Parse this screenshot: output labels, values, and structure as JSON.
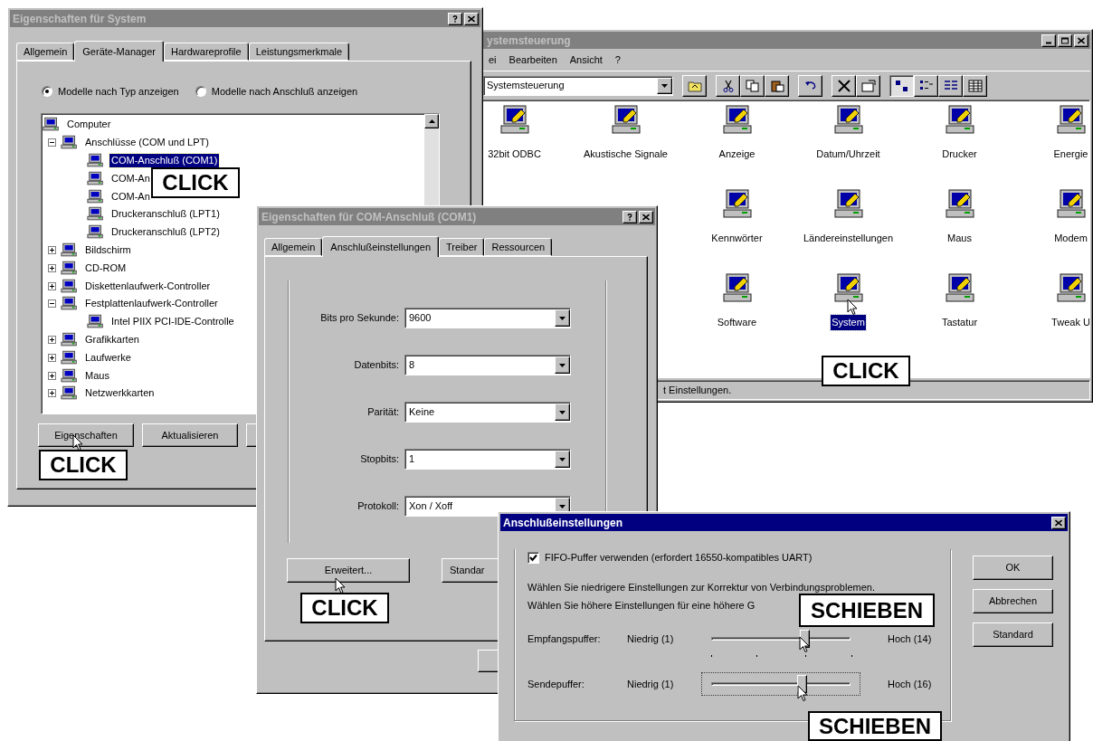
{
  "system_properties": {
    "title": "Eigenschaften für System",
    "active": false,
    "tabs": [
      {
        "label": "Allgemein",
        "selected": false
      },
      {
        "label": "Geräte-Manager",
        "selected": true
      },
      {
        "label": "Hardwareprofile",
        "selected": false
      },
      {
        "label": "Leistungsmerkmale",
        "selected": false
      }
    ],
    "view_options": [
      {
        "label": "Modelle nach Typ anzeigen",
        "selected": true
      },
      {
        "label": "Modelle nach Anschluß anzeigen",
        "selected": false
      }
    ],
    "device_tree": [
      {
        "label": "Computer",
        "selected": false,
        "children": [
          {
            "label": "Anschlüsse (COM und LPT)",
            "selected": false,
            "expanded": true,
            "children": [
              {
                "label": "COM-Anschluß (COM1)",
                "selected": true
              },
              {
                "label": "COM-An",
                "selected": false
              },
              {
                "label": "COM-An",
                "selected": false
              },
              {
                "label": "Druckeranschluß (LPT1)",
                "selected": false
              },
              {
                "label": "Druckeranschluß (LPT2)",
                "selected": false
              }
            ]
          },
          {
            "label": "Bildschirm",
            "selected": false,
            "expanded": false
          },
          {
            "label": "CD-ROM",
            "selected": false,
            "expanded": false
          },
          {
            "label": "Diskettenlaufwerk-Controller",
            "selected": false,
            "expanded": false
          },
          {
            "label": "Festplattenlaufwerk-Controller",
            "selected": false,
            "expanded": true,
            "children": [
              {
                "label": "Intel PIIX PCI-IDE-Controlle",
                "selected": false
              }
            ]
          },
          {
            "label": "Grafikkarten",
            "selected": false,
            "expanded": false
          },
          {
            "label": "Laufwerke",
            "selected": false,
            "expanded": false
          },
          {
            "label": "Maus",
            "selected": false,
            "expanded": false
          },
          {
            "label": "Netzwerkkarten",
            "selected": false,
            "expanded": false
          }
        ]
      }
    ],
    "buttons": [
      "Eigenschaften",
      "Aktualisieren"
    ]
  },
  "control_panel": {
    "title": "ystemsteuerung",
    "active": false,
    "menu": [
      "ei",
      "Bearbeiten",
      "Ansicht",
      "?"
    ],
    "address": "Systemsteuerung",
    "view_modes": [
      {
        "selected": true
      },
      {
        "selected": false
      },
      {
        "selected": false
      },
      {
        "selected": false
      }
    ],
    "icon_rows": [
      [
        {
          "label": "32bit ODBC",
          "selected": false
        },
        {
          "label": "Akustische Signale",
          "selected": false
        },
        {
          "label": "Anzeige",
          "selected": false
        },
        {
          "label": "Datum/Uhrzeit",
          "selected": false
        },
        {
          "label": "Drucker",
          "selected": false
        },
        {
          "label": "Energie",
          "selected": false
        }
      ],
      [
        {
          "label": "Kennwörter",
          "selected": false
        },
        {
          "label": "Ländereinstellungen",
          "selected": false
        },
        {
          "label": "Maus",
          "selected": false
        },
        {
          "label": "Modem",
          "selected": false
        }
      ],
      [
        {
          "label": "Software",
          "selected": false
        },
        {
          "label": "System",
          "selected": true
        },
        {
          "label": "Tastatur",
          "selected": false
        },
        {
          "label": "Tweak U",
          "selected": false
        }
      ]
    ],
    "status": "t Einstellungen."
  },
  "port_properties": {
    "title": "Eigenschaften für COM-Anschluß (COM1)",
    "active": false,
    "tabs": [
      {
        "label": "Allgemein",
        "selected": false
      },
      {
        "label": "Anschlußeinstellungen",
        "selected": true
      },
      {
        "label": "Treiber",
        "selected": false
      },
      {
        "label": "Ressourcen",
        "selected": false
      }
    ],
    "fields": [
      {
        "label": "Bits pro Sekunde:",
        "value": "9600"
      },
      {
        "label": "Datenbits:",
        "value": "8"
      },
      {
        "label": "Parität:",
        "value": "Keine"
      },
      {
        "label": "Stopbits:",
        "value": "1"
      },
      {
        "label": "Protokoll:",
        "value": "Xon / Xoff"
      }
    ],
    "buttons": [
      "Erweitert...",
      "Standar"
    ]
  },
  "advanced_settings": {
    "title": "Anschlußeinstellungen",
    "active": true,
    "fifo": {
      "label": "FIFO-Puffer verwenden (erfordert 16550-kompatibles UART)",
      "checked": true
    },
    "hints": [
      "Wählen Sie niedrigere Einstellungen zur Korrektur von Verbindungsproblemen.",
      "Wählen Sie höhere Einstellungen für eine höhere G"
    ],
    "sliders": [
      {
        "label": "Empfangspuffer:",
        "min": "Niedrig (1)",
        "max": "Hoch (14)",
        "level": 0.67,
        "focused": false
      },
      {
        "label": "Sendepuffer:",
        "min": "Niedrig (1)",
        "max": "Hoch (16)",
        "level": 0.65,
        "focused": true
      }
    ],
    "buttons": [
      "OK",
      "Abbrechen",
      "Standard"
    ]
  },
  "callouts": [
    "CLICK",
    "CLICK",
    "CLICK",
    "CLICK",
    "SCHIEBEN",
    "SCHIEBEN"
  ]
}
